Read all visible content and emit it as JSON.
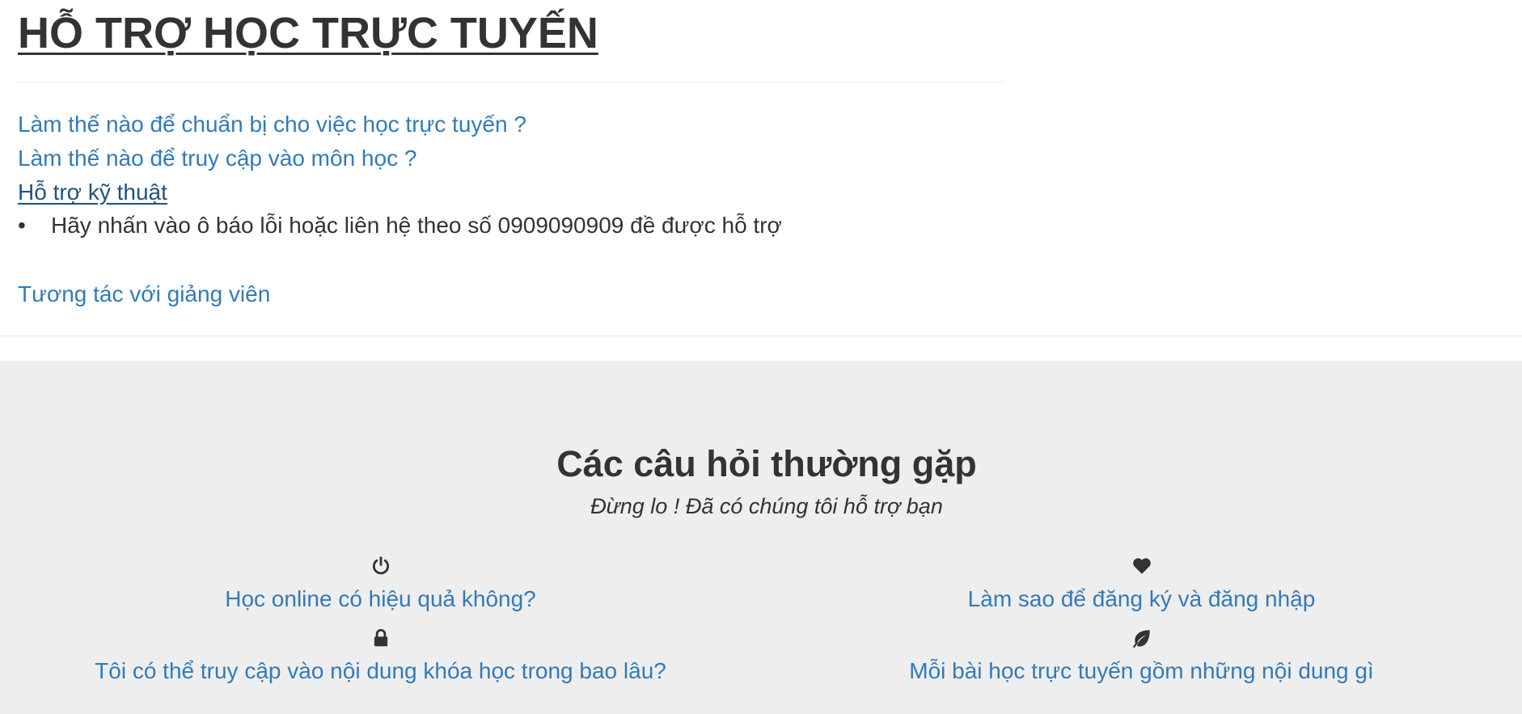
{
  "page": {
    "title": "HỖ TRỢ HỌC TRỰC TUYẾN"
  },
  "support_links": [
    {
      "label": "Làm thế nào để chuẩn bị cho việc học trực tuyến ?"
    },
    {
      "label": "Làm thế nào để truy cập vào môn học ?"
    },
    {
      "label": "Hỗ trợ kỹ thuật"
    }
  ],
  "technical_support": {
    "bullet": "Hãy nhấn vào ô báo lỗi hoặc liên hệ theo số 0909090909 đề được hỗ trợ"
  },
  "interaction_link": {
    "label": "Tương tác với giảng viên"
  },
  "faq": {
    "title": "Các câu hỏi thường gặp",
    "subtitle": "Đừng lo ! Đã có chúng tôi hỗ trợ bạn",
    "items": [
      {
        "icon": "power-icon",
        "question": "Học online có hiệu quả không?"
      },
      {
        "icon": "heart-icon",
        "question": "Làm sao để đăng ký và đăng nhập"
      },
      {
        "icon": "lock-icon",
        "question": "Tôi có thể truy cập vào nội dung khóa học trong bao lâu?"
      },
      {
        "icon": "leaf-icon",
        "question": "Mỗi bài học trực tuyến gồm những nội dung gì"
      }
    ]
  },
  "colors": {
    "link": "#337ab7",
    "link_hover": "#23527c",
    "text": "#333333",
    "faq_background": "#eeeeee"
  }
}
